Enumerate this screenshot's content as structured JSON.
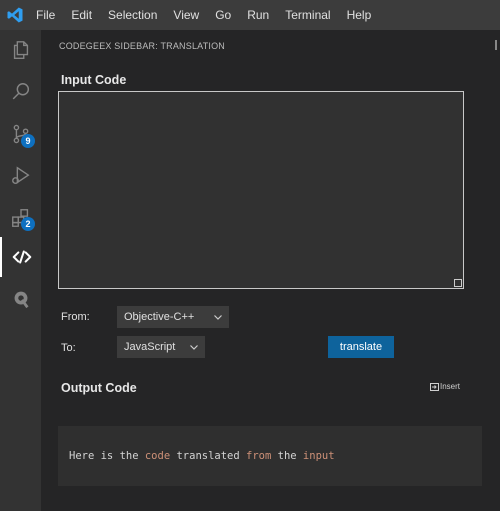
{
  "menu": [
    "File",
    "Edit",
    "Selection",
    "View",
    "Go",
    "Run",
    "Terminal",
    "Help"
  ],
  "activity_bar": {
    "items": [
      {
        "name": "explorer-icon"
      },
      {
        "name": "search-icon"
      },
      {
        "name": "source-control-icon",
        "badge": "9"
      },
      {
        "name": "run-debug-icon"
      },
      {
        "name": "extensions-icon",
        "badge": "2"
      },
      {
        "name": "codegeex-icon",
        "active": true
      },
      {
        "name": "extension-q-icon"
      }
    ]
  },
  "sidebar": {
    "title": "CODEGEEX SIDEBAR: TRANSLATION",
    "input_code_label": "Input Code",
    "input_code_value": "",
    "from_label": "From:",
    "from_value": "Objective-C++",
    "to_label": "To:",
    "to_value": "JavaScript",
    "translate_label": "translate",
    "output_code_label": "Output Code",
    "insert_label": "Insert",
    "output": {
      "part1": "Here is the ",
      "word1": "code",
      "part2": " translated ",
      "word2": "from",
      "part3": " the ",
      "word3": "input"
    }
  },
  "colors": {
    "accent": "#0e639c",
    "badge": "#0e70c0",
    "highlight": "#ce9178"
  }
}
